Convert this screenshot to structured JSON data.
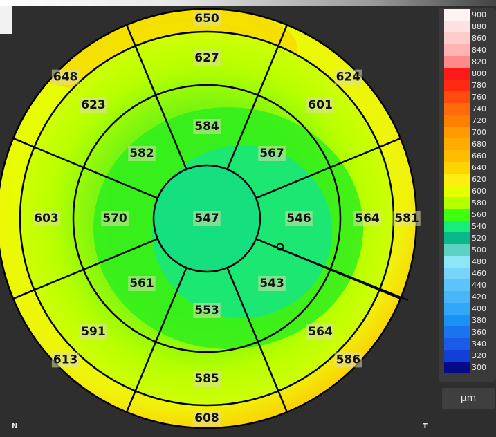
{
  "map": {
    "center": "547",
    "inner_ring": [
      "584",
      "567",
      "546",
      "543",
      "553",
      "561",
      "570",
      "582"
    ],
    "middle_ring": [
      "627",
      "601",
      "564",
      "564",
      "585",
      "591",
      "603",
      "623"
    ],
    "outer_ring": [
      "650",
      "624",
      "581",
      "586",
      "608",
      "613",
      "603",
      "648"
    ]
  },
  "orientation": {
    "left": "N",
    "right": "T"
  },
  "legend": {
    "unit": "µm",
    "items": [
      {
        "label": "900",
        "color": "#fff3f3"
      },
      {
        "label": "880",
        "color": "#ffe1e1"
      },
      {
        "label": "860",
        "color": "#ffcccc"
      },
      {
        "label": "840",
        "color": "#ffb3b3"
      },
      {
        "label": "820",
        "color": "#ff8a8a"
      },
      {
        "label": "800",
        "color": "#ff1a1a"
      },
      {
        "label": "780",
        "color": "#ff2a10"
      },
      {
        "label": "760",
        "color": "#ff4a10"
      },
      {
        "label": "740",
        "color": "#ff6a0a"
      },
      {
        "label": "720",
        "color": "#ff8000"
      },
      {
        "label": "700",
        "color": "#ff9a00"
      },
      {
        "label": "680",
        "color": "#ffac00"
      },
      {
        "label": "660",
        "color": "#ffbc00"
      },
      {
        "label": "640",
        "color": "#ffd400"
      },
      {
        "label": "620",
        "color": "#ffee10"
      },
      {
        "label": "600",
        "color": "#e6ff00"
      },
      {
        "label": "580",
        "color": "#b4ff00"
      },
      {
        "label": "560",
        "color": "#3cff12"
      },
      {
        "label": "540",
        "color": "#18ec7a"
      },
      {
        "label": "520",
        "color": "#0ab88a"
      },
      {
        "label": "500",
        "color": "#5ed2c2"
      },
      {
        "label": "480",
        "color": "#8ce6f8"
      },
      {
        "label": "460",
        "color": "#78d4fa"
      },
      {
        "label": "440",
        "color": "#5cc4fa"
      },
      {
        "label": "420",
        "color": "#4ab6fa"
      },
      {
        "label": "400",
        "color": "#32a6f8"
      },
      {
        "label": "380",
        "color": "#1a92f4"
      },
      {
        "label": "360",
        "color": "#1a74ee"
      },
      {
        "label": "340",
        "color": "#1a5ce8"
      },
      {
        "label": "320",
        "color": "#1040d8"
      },
      {
        "label": "300",
        "color": "#060a86"
      }
    ]
  },
  "colors": {
    "background": "#2e2e2e",
    "outer_ring_fill": "#ffd700",
    "middle_ring_fill": "#d8ff10",
    "inner_ring_fill": "#40f020",
    "center_fill": "#18e37f",
    "grid_line": "#000000"
  }
}
